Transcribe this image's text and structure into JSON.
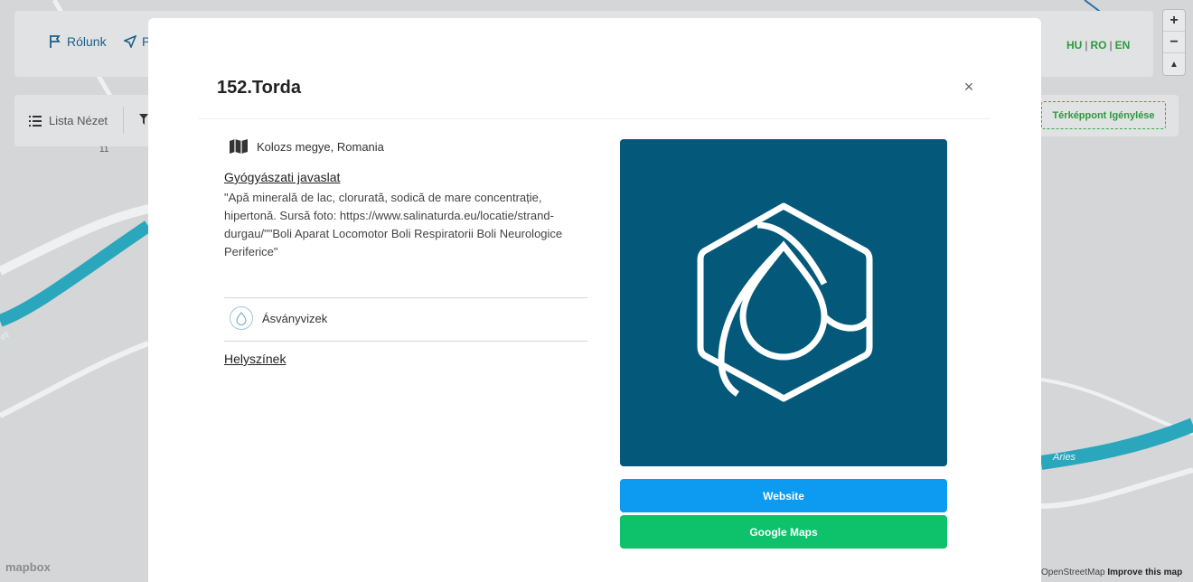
{
  "background": {
    "nav": [
      {
        "label": "Rólunk",
        "icon": "flag-icon"
      },
      {
        "label": "P",
        "icon": "send-icon"
      }
    ],
    "languages": [
      "HU",
      "RO",
      "EN"
    ],
    "list_view_label": "Lista Nézet",
    "request_point_label": "Térképpont Igénylése",
    "zoom_in": "+",
    "zoom_out": "−",
    "compass": "▲",
    "map_labels": {
      "road_number": "11",
      "river": "Aries",
      "river_left": "eș"
    },
    "mapbox_logo": "mapbox",
    "attribution_osm": "OpenStreetMap",
    "attribution_improve": "Improve this map"
  },
  "modal": {
    "title": "152.Torda",
    "close_label": "×",
    "location": "Kolozs megye, Romania",
    "therapy_heading": "Gyógyászati javaslat",
    "therapy_text": "\"Apă minerală de lac, clorurată, sodică de mare concentrație, hipertonă. Sursă foto: https://www.salinaturda.eu/locatie/strand-durgau/\"\"Boli Aparat Locomotor Boli Respiratorii Boli Neurologice Periferice\"",
    "category": "Ásványvizek",
    "places_heading": "Helyszínek",
    "website_button": "Website",
    "maps_button": "Google Maps"
  },
  "colors": {
    "image_bg": "#04597a",
    "website_btn": "#0d9bf2",
    "maps_btn": "#0ec16b",
    "river": "#2aa7bd",
    "accent_green": "#2c9a3d"
  }
}
